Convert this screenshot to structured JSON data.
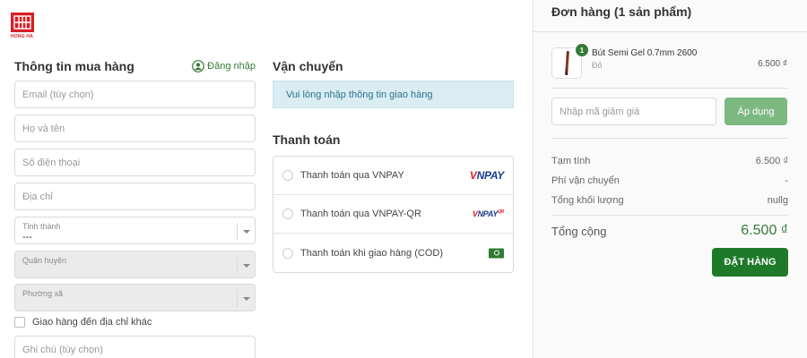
{
  "brand": {
    "name": "HONG HA",
    "logo_color": "#d71f26"
  },
  "buyer": {
    "title": "Thông tin mua hàng",
    "login_label": "Đăng nhập",
    "email_placeholder": "Email (tùy chọn)",
    "name_placeholder": "Họ và tên",
    "phone_placeholder": "Số điện thoại",
    "address_placeholder": "Địa chỉ",
    "province": {
      "label": "Tỉnh thành",
      "value": "---"
    },
    "district": {
      "label": "Quận huyện"
    },
    "ward": {
      "label": "Phường xã"
    },
    "ship_other_label": "Giao hàng đến địa chỉ khác",
    "note_placeholder": "Ghi chú (tùy chọn)"
  },
  "shipping": {
    "title": "Vận chuyển",
    "notice": "Vui lòng nhập thông tin giao hàng"
  },
  "payment": {
    "title": "Thanh toán",
    "methods": [
      {
        "label": "Thanh toán qua VNPAY",
        "icon": "vnpay-logo"
      },
      {
        "label": "Thanh toán qua VNPAY-QR",
        "icon": "vnpay-qr-logo"
      },
      {
        "label": "Thanh toán khi giao hàng (COD)",
        "icon": "cash-icon"
      }
    ]
  },
  "order": {
    "title": "Đơn hàng (1 sản phẩm)",
    "item": {
      "name": "Bút Semi Gel 0.7mm 2600",
      "variant": "Đỏ",
      "price": "6.500 ₫",
      "quantity": "1"
    },
    "coupon_placeholder": "Nhập mã giảm giá",
    "apply_label": "Áp dụng",
    "subtotal_label": "Tạm tính",
    "subtotal_value": "6.500 ₫",
    "shipping_label": "Phí vận chuyển",
    "shipping_value": "-",
    "weight_label": "Tổng khối lượng",
    "weight_value": "nullg",
    "total_label": "Tổng cộng",
    "total_value": "6.500 ₫",
    "place_order_label": "ĐẶT HÀNG",
    "accent_color": "#357a38"
  }
}
